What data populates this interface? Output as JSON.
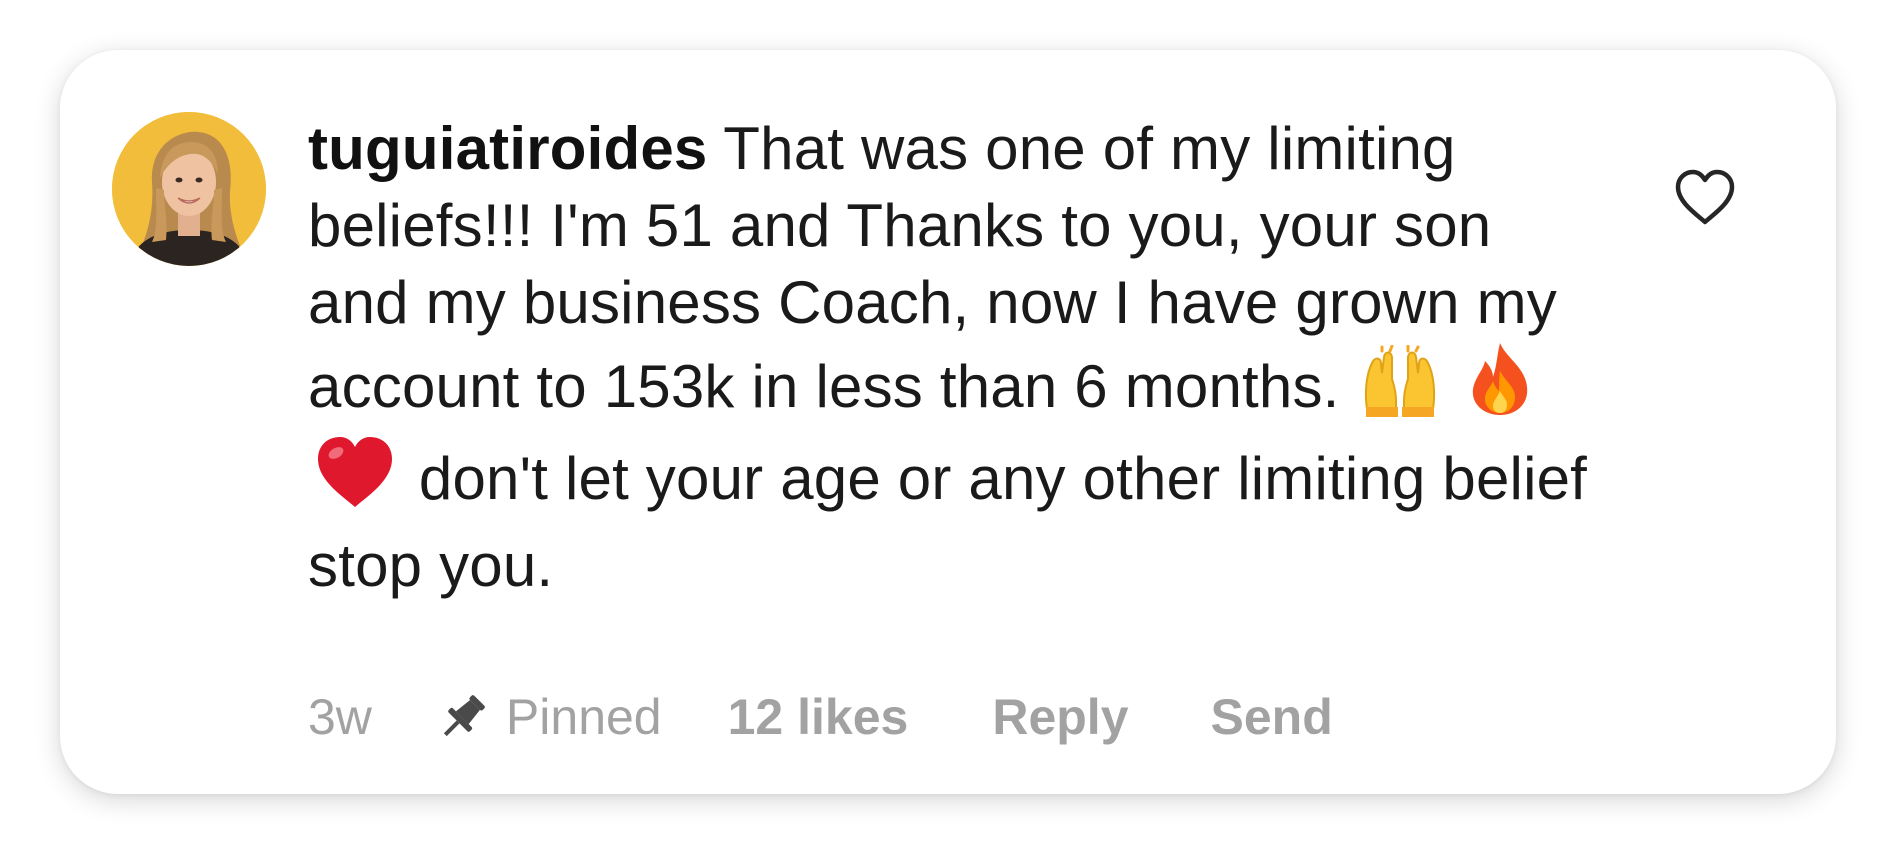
{
  "comment": {
    "username": "tuguiatiroides",
    "text_before_emojis": " That was one of my limiting beliefs!!! I'm 51 and Thanks to you, your son and my business Coach, now I have grown my account to 153k in less than 6 months.",
    "emojis": [
      "raising-hands-emoji",
      "fire-emoji",
      "red-heart-emoji"
    ],
    "text_after_emojis": " don't let your age or any other limiting belief stop you."
  },
  "meta": {
    "time": "3w",
    "pinned_label": "Pinned",
    "likes_label": "12 likes",
    "reply_label": "Reply",
    "send_label": "Send"
  },
  "icons": {
    "like": "heart-outline-icon",
    "pinned": "pin-icon"
  },
  "colors": {
    "avatar_background": "#f2bd3a",
    "meta_text": "#a2a2a2",
    "body_text": "#1a1a1a"
  }
}
